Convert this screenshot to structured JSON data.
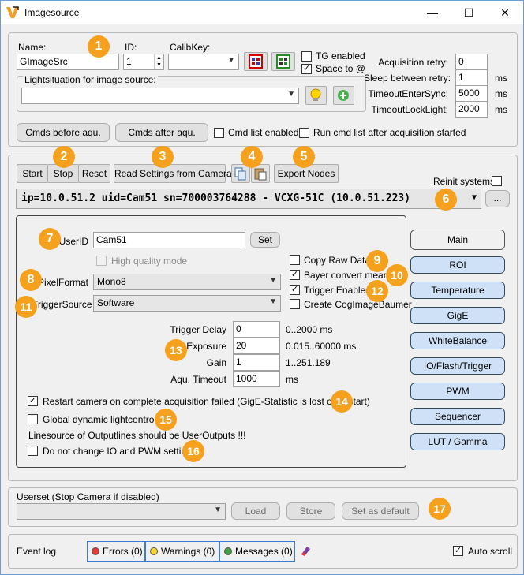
{
  "window": {
    "title": "Imagesource",
    "minimize": "—",
    "maximize": "☐",
    "close": "✕"
  },
  "source": {
    "name_label": "Name:",
    "name_value": "GImageSrc",
    "id_label": "ID:",
    "id_value": "1",
    "calibkey_label": "CalibKey:",
    "calibkey_value": "",
    "tg_enabled_label": "TG enabled",
    "tg_enabled": false,
    "space_label": "Space to @",
    "space": true,
    "lightsituation_label": "Lightsituation for image source:",
    "lightsituation_value": "",
    "cmds_before_label": "Cmds before aqu.",
    "cmds_after_label": "Cmds after aqu.",
    "cmd_list_enabled_label": "Cmd list enabled",
    "cmd_list_enabled": false,
    "run_cmd_list_label": "Run cmd list after acquisition started",
    "run_cmd_list": false
  },
  "timing": {
    "acq_retry_label": "Acquisition retry:",
    "acq_retry_value": "0",
    "sleep_label": "Sleep between retry:",
    "sleep_value": "1",
    "sleep_unit": "ms",
    "timeout_enter_label": "TimeoutEnterSync:",
    "timeout_enter_value": "5000",
    "timeout_enter_unit": "ms",
    "timeout_lock_label": "TimeoutLockLight:",
    "timeout_lock_value": "2000",
    "timeout_lock_unit": "ms"
  },
  "toolbar": {
    "start": "Start",
    "stop": "Stop",
    "reset": "Reset",
    "read_settings": "Read Settings from Camera",
    "export_nodes": "Export Nodes",
    "reinit_label": "Reinit systems",
    "reinit": false,
    "ellipsis": "..."
  },
  "camera": {
    "selected": "ip=10.0.51.2 uid=Cam51 sn=700003764288 - VCXG-51C (10.0.51.223)"
  },
  "settings": {
    "userid_label": "UserID",
    "userid_value": "Cam51",
    "set_label": "Set",
    "hq_label": "High quality mode",
    "pixelformat_label": "PixelFormat",
    "pixelformat_value": "Mono8",
    "triggersource_label": "TriggerSource",
    "triggersource_value": "Software",
    "copy_raw_label": "Copy Raw Data",
    "copy_raw": false,
    "bayer_label": "Bayer convert mean",
    "bayer": true,
    "trigger_enabled_label": "Trigger Enabled",
    "trigger_enabled": true,
    "create_cog_label": "Create CogImageBaumer",
    "create_cog": false,
    "trigger_delay_label": "Trigger Delay",
    "trigger_delay_value": "0",
    "trigger_delay_range": "0..2000 ms",
    "exposure_label": "Exposure",
    "exposure_value": "20",
    "exposure_range": "0.015..60000 ms",
    "gain_label": "Gain",
    "gain_value": "1",
    "gain_range": "1..251.189",
    "aqu_timeout_label": "Aqu. Timeout",
    "aqu_timeout_value": "1000",
    "aqu_timeout_unit": "ms",
    "restart_label": "Restart camera on complete acquisition failed (GigE-Statistic is lost on restart)",
    "restart": true,
    "global_light_label": "Global dynamic lightcontroller",
    "global_light": false,
    "linesource_note": "Linesource of Outputlines should be UserOutputs !!!",
    "no_change_io_label": "Do not change IO and PWM settings",
    "no_change_io": false
  },
  "nav": [
    "Main",
    "ROI",
    "Temperature",
    "GigE",
    "WhiteBalance",
    "IO/Flash/Trigger",
    "PWM",
    "Sequencer",
    "LUT / Gamma"
  ],
  "userset": {
    "label": "Userset (Stop Camera if disabled)",
    "value": "",
    "load": "Load",
    "store": "Store",
    "set_default": "Set as default"
  },
  "eventlog": {
    "label": "Event log",
    "errors": "Errors (0)",
    "warnings": "Warnings (0)",
    "messages": "Messages (0)",
    "autoscroll_label": "Auto scroll",
    "autoscroll": true
  },
  "badges": [
    "1",
    "2",
    "3",
    "4",
    "5",
    "6",
    "7",
    "8",
    "9",
    "10",
    "11",
    "12",
    "13",
    "14",
    "15",
    "16",
    "17"
  ],
  "colors": {
    "badge": "#f5a11d",
    "nav_button": "#cfe1f7",
    "error_dot": "#e53935",
    "warning_dot": "#fdd835",
    "message_dot": "#43a047"
  }
}
